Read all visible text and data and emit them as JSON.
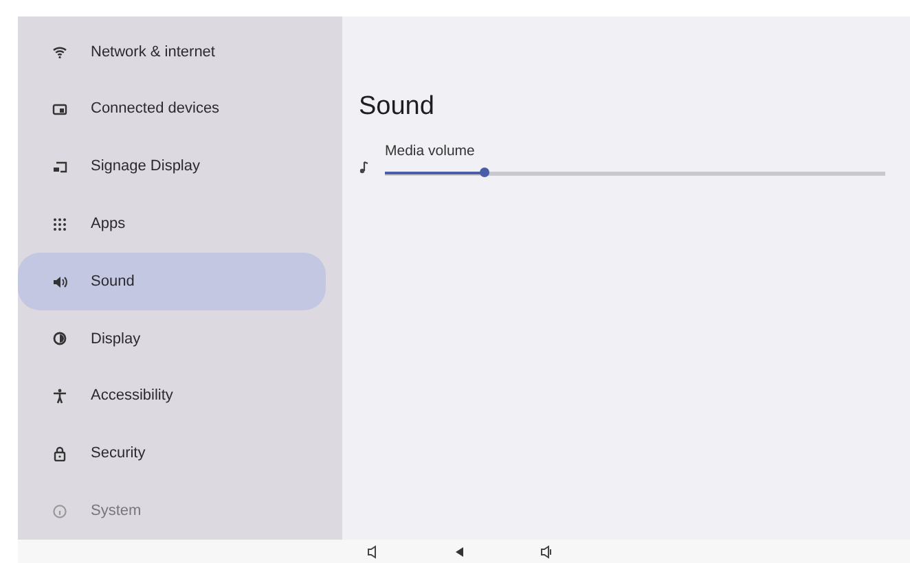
{
  "sidebar": {
    "items": [
      {
        "label": "Network & internet",
        "selected": false,
        "dimmed": false
      },
      {
        "label": "Connected devices",
        "selected": false,
        "dimmed": false
      },
      {
        "label": "Signage Display",
        "selected": false,
        "dimmed": false
      },
      {
        "label": "Apps",
        "selected": false,
        "dimmed": false
      },
      {
        "label": "Sound",
        "selected": true,
        "dimmed": false
      },
      {
        "label": "Display",
        "selected": false,
        "dimmed": false
      },
      {
        "label": "Accessibility",
        "selected": false,
        "dimmed": false
      },
      {
        "label": "Security",
        "selected": false,
        "dimmed": false
      },
      {
        "label": "System",
        "selected": false,
        "dimmed": true
      }
    ]
  },
  "page": {
    "title": "Sound",
    "sliders": [
      {
        "label": "Media volume",
        "level": 0.2
      }
    ]
  }
}
